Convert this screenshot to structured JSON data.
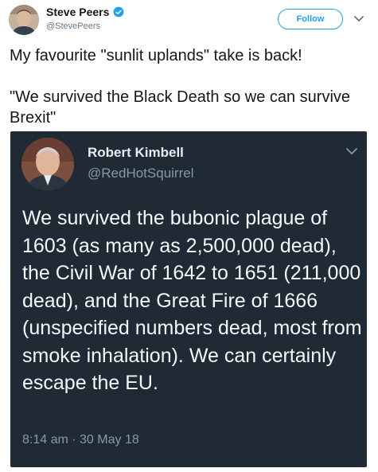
{
  "tweet": {
    "author_name": "Steve Peers",
    "author_handle": "@StevePeers",
    "verified_icon": "verified-badge-icon",
    "follow_label": "Follow",
    "menu_icon": "chevron-down-icon",
    "text_line1": "My favourite \"sunlit uplands\" take is back!",
    "text_line2": "\"We survived the Black Death so we can survive Brexit\""
  },
  "embedded": {
    "author_name": "Robert Kimbell",
    "author_handle": "@RedHotSquirrel",
    "menu_icon": "chevron-down-icon",
    "text": "We survived the bubonic plague of 1603 (as many as 2,500,000 dead), the Civil War of 1642 to 1651 (211,000 dead), and the Great Fire of 1666 (unspecified numbers dead, most from smoke inhalation). We can certainly escape the EU.",
    "timestamp": "8:14 am · 30 May 18"
  },
  "colors": {
    "accent": "#1da1f2",
    "embed_background": "#1f2a35",
    "muted_text": "#8899a6"
  }
}
